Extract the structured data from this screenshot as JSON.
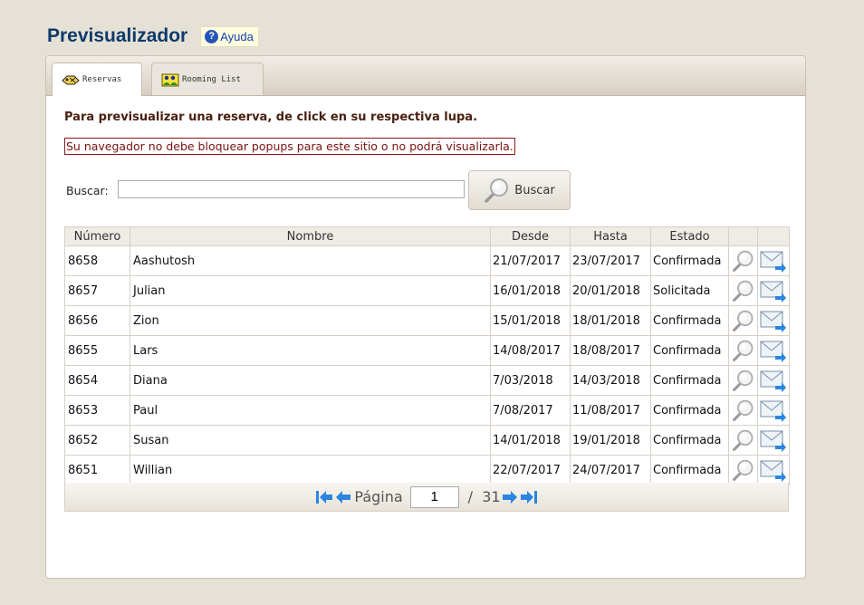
{
  "header": {
    "title": "Previsualizador",
    "help_label": "Ayuda"
  },
  "tabs": [
    {
      "label": "Reservas"
    },
    {
      "label": "Rooming List"
    }
  ],
  "main": {
    "instructions": "Para previsualizar una reserva, de click en su respectiva lupa.",
    "warning": "Su navegador no debe bloquear popups para este sitio o no podrá visualizarla.",
    "search_label": "Buscar:",
    "search_value": "",
    "search_button": "Buscar"
  },
  "table": {
    "columns": [
      "Número",
      "Nombre",
      "Desde",
      "Hasta",
      "Estado",
      "",
      ""
    ],
    "rows": [
      {
        "numero": "8658",
        "nombre": "Aashutosh",
        "desde": "21/07/2017",
        "hasta": "23/07/2017",
        "estado": "Confirmada"
      },
      {
        "numero": "8657",
        "nombre": "Julian",
        "desde": "16/01/2018",
        "hasta": "20/01/2018",
        "estado": "Solicitada"
      },
      {
        "numero": "8656",
        "nombre": "Zion",
        "desde": "15/01/2018",
        "hasta": "18/01/2018",
        "estado": "Confirmada"
      },
      {
        "numero": "8655",
        "nombre": "Lars",
        "desde": "14/08/2017",
        "hasta": "18/08/2017",
        "estado": "Confirmada"
      },
      {
        "numero": "8654",
        "nombre": "Diana",
        "desde": "7/03/2018",
        "hasta": "14/03/2018",
        "estado": "Confirmada"
      },
      {
        "numero": "8653",
        "nombre": "Paul",
        "desde": "7/08/2017",
        "hasta": "11/08/2017",
        "estado": "Confirmada"
      },
      {
        "numero": "8652",
        "nombre": "Susan",
        "desde": "14/01/2018",
        "hasta": "19/01/2018",
        "estado": "Confirmada"
      },
      {
        "numero": "8651",
        "nombre": "Willian",
        "desde": "22/07/2017",
        "hasta": "24/07/2017",
        "estado": "Confirmada"
      }
    ]
  },
  "pager": {
    "label": "Página",
    "current": "1",
    "total": "/  31"
  },
  "icons": {
    "help": "help-icon",
    "reservas": "reservas-icon",
    "rooming": "rooming-list-icon",
    "search": "magnifier-icon",
    "view": "magnifier-icon",
    "email": "email-send-icon",
    "first": "first-page-icon",
    "prev": "prev-page-icon",
    "next": "next-page-icon",
    "last": "last-page-icon"
  },
  "colors": {
    "background": "#e6e1d6",
    "title": "#0d3a6a",
    "warning": "#7a1010",
    "nav_arrows": "#2a86e0"
  }
}
